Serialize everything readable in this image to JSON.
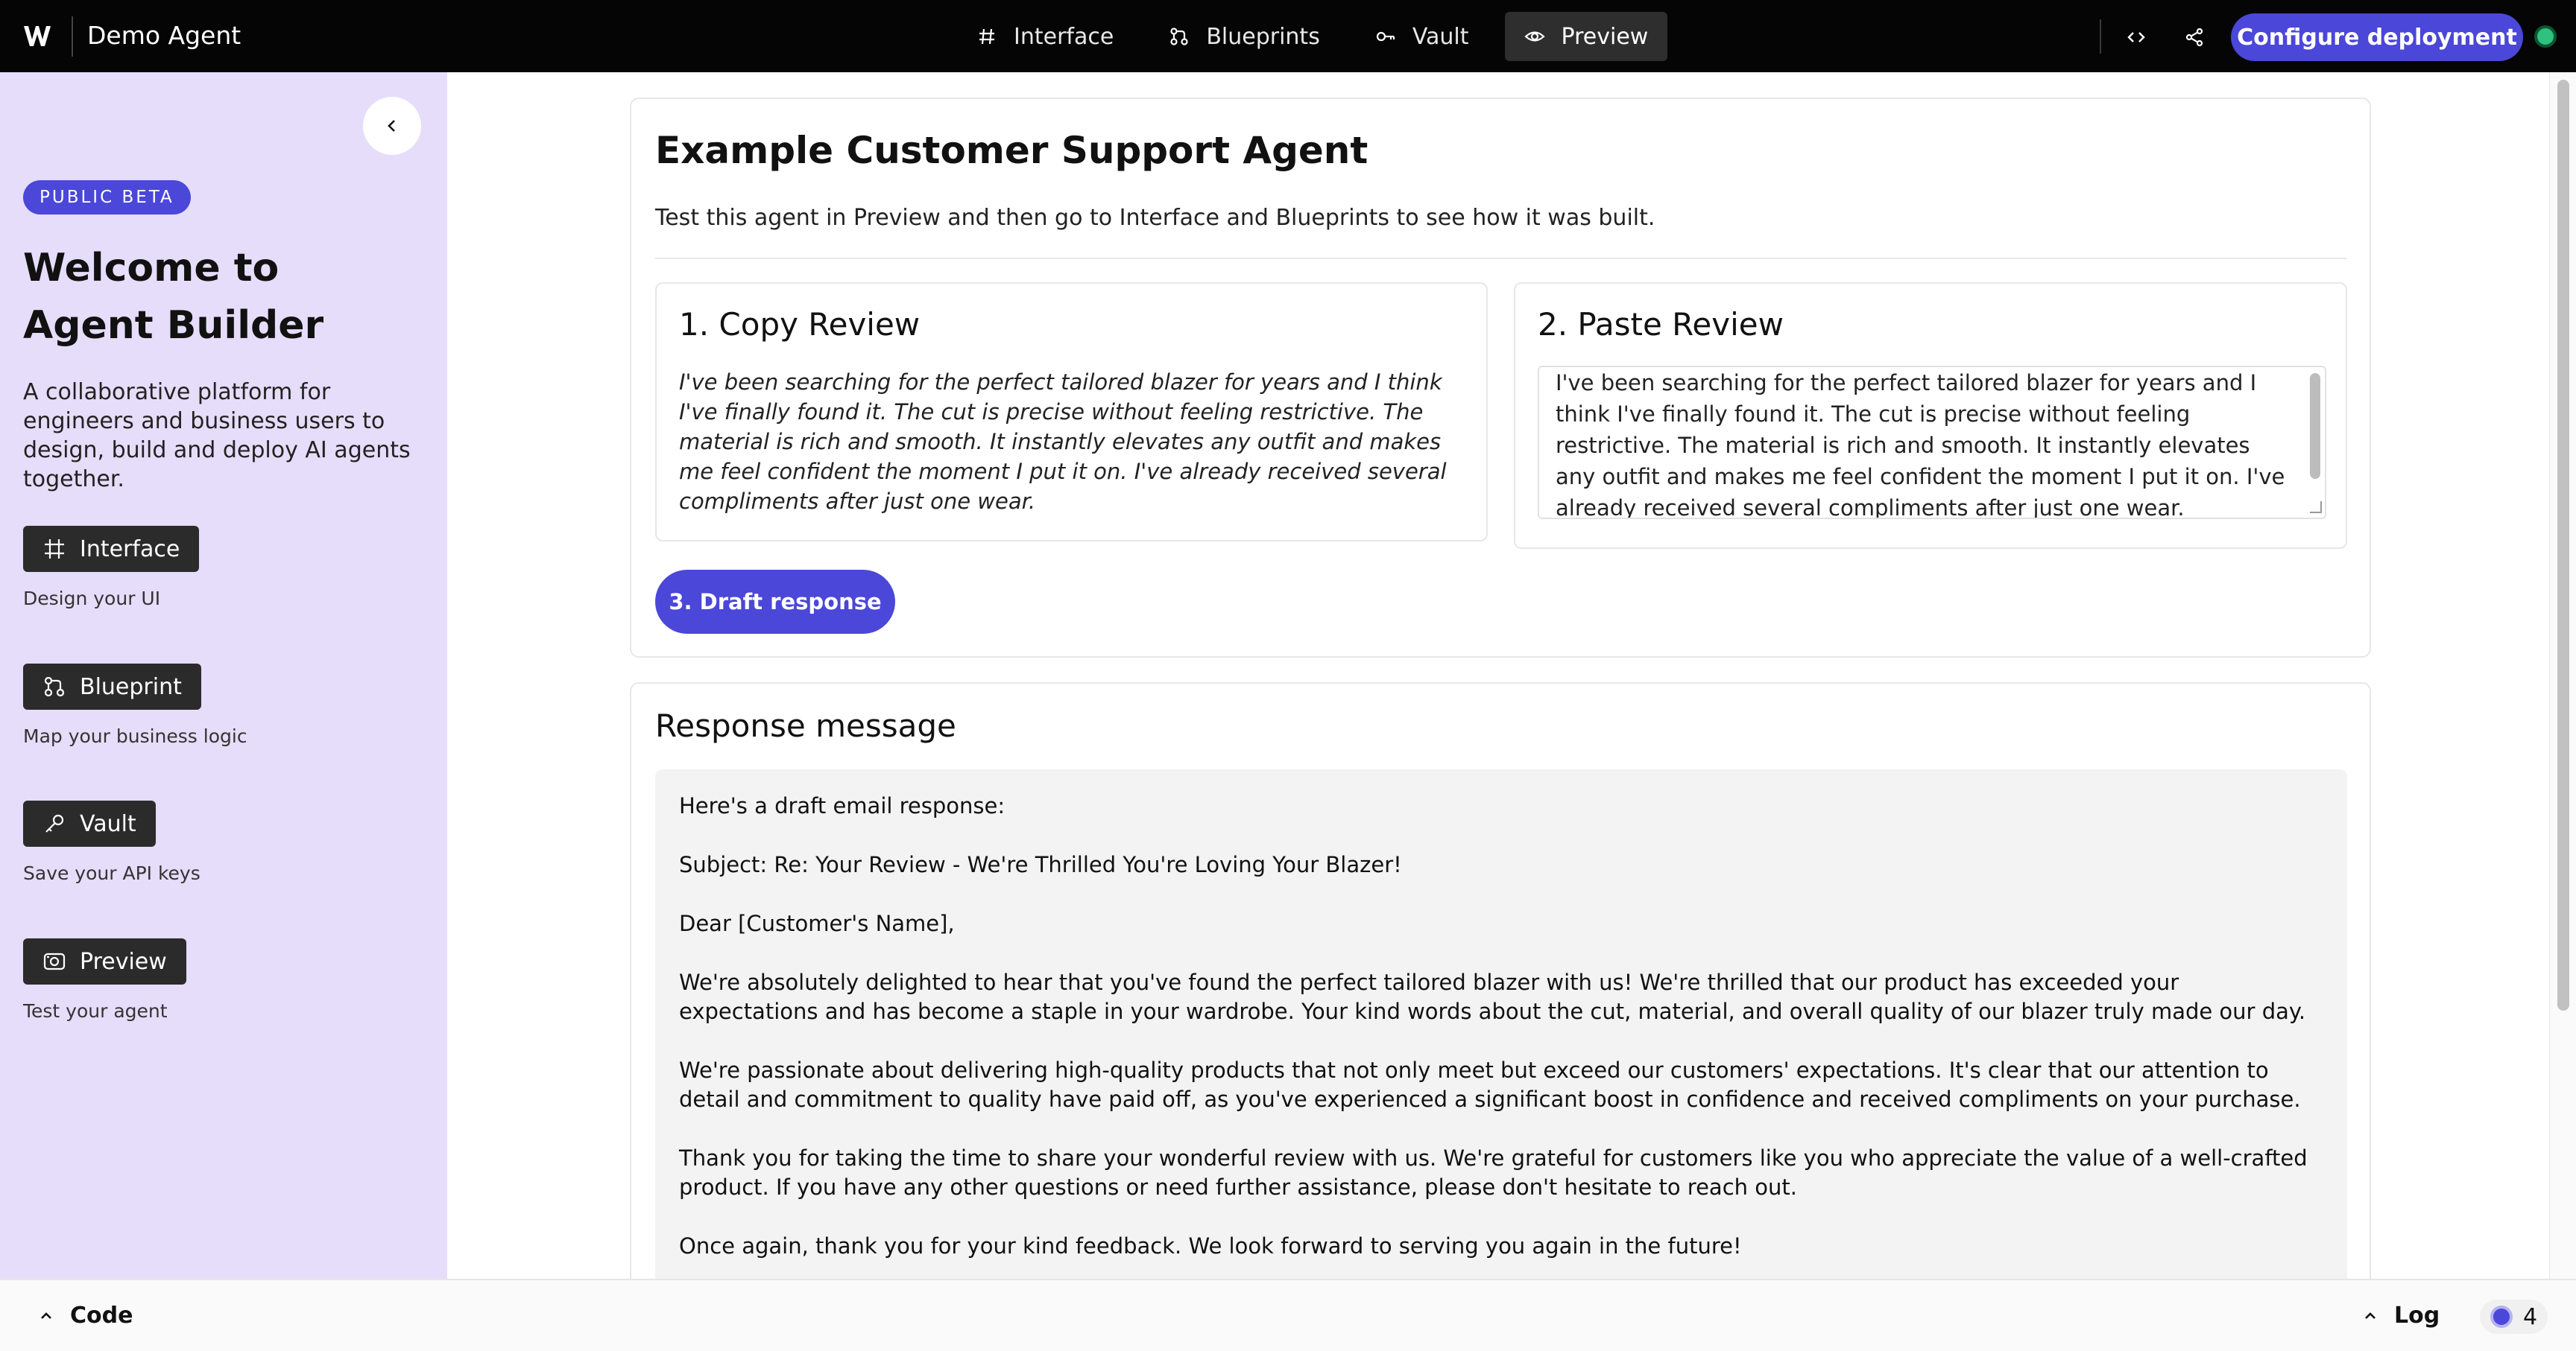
{
  "app": {
    "title": "Demo Agent"
  },
  "nav": {
    "items": [
      {
        "label": "Interface",
        "icon": "hash-icon"
      },
      {
        "label": "Blueprints",
        "icon": "blueprint-icon"
      },
      {
        "label": "Vault",
        "icon": "key-icon"
      },
      {
        "label": "Preview",
        "icon": "eye-icon"
      }
    ],
    "active": "Preview"
  },
  "header": {
    "deploy_label": "Configure deployment",
    "status": "online"
  },
  "sidebar": {
    "badge": "PUBLIC BETA",
    "title": "Welcome to Agent Builder",
    "description": "A collaborative platform for engineers and business users to design, build and deploy AI agents together.",
    "items": [
      {
        "label": "Interface",
        "caption": "Design your UI",
        "icon": "hash-icon"
      },
      {
        "label": "Blueprint",
        "caption": "Map your business logic",
        "icon": "blueprint-icon"
      },
      {
        "label": "Vault",
        "caption": "Save your API keys",
        "icon": "key-icon"
      },
      {
        "label": "Preview",
        "caption": "Test your agent",
        "icon": "camera-icon"
      }
    ]
  },
  "main": {
    "title": "Example Customer Support Agent",
    "description": "Test this agent in Preview and then go to Interface and Blueprints to see how it was built.",
    "copy_title": "1. Copy Review",
    "copy_text": "I've been searching for the perfect tailored blazer for years and I think I've finally found it. The cut is precise without feeling restrictive. The material is rich and smooth. It instantly elevates any outfit and makes me feel confident the moment I put it on. I've already received several compliments after just one wear.",
    "paste_title": "2. Paste Review",
    "paste_value": "I've been searching for the perfect tailored blazer for years and I think I've finally found it. The cut is precise without feeling restrictive. The material is rich and smooth. It instantly elevates any outfit and makes me feel confident the moment I put it on. I've already received several compliments after just one wear.",
    "draft_label": "3. Draft response"
  },
  "response": {
    "title": "Response message",
    "paragraphs": [
      "Here's a draft email response:",
      "Subject: Re: Your Review - We're Thrilled You're Loving Your Blazer!",
      "Dear [Customer's Name],",
      "We're absolutely delighted to hear that you've found the perfect tailored blazer with us! We're thrilled that our product has exceeded your expectations and has become a staple in your wardrobe. Your kind words about the cut, material, and overall quality of our blazer truly made our day.",
      "We're passionate about delivering high-quality products that not only meet but exceed our customers' expectations. It's clear that our attention to detail and commitment to quality have paid off, as you've experienced a significant boost in confidence and received compliments on your purchase.",
      "Thank you for taking the time to share your wonderful review with us. We're grateful for customers like you who appreciate the value of a well-crafted product. If you have any other questions or need further assistance, please don't hesitate to reach out.",
      "Once again, thank you for your kind feedback. We look forward to serving you again in the future!"
    ]
  },
  "bottom": {
    "code_label": "Code",
    "log_label": "Log",
    "credits": "4"
  },
  "colors": {
    "accent": "#4b47d8",
    "sidebar_bg": "#e6ddfa",
    "topbar_bg": "#050505",
    "status_green": "#2ec27e"
  }
}
